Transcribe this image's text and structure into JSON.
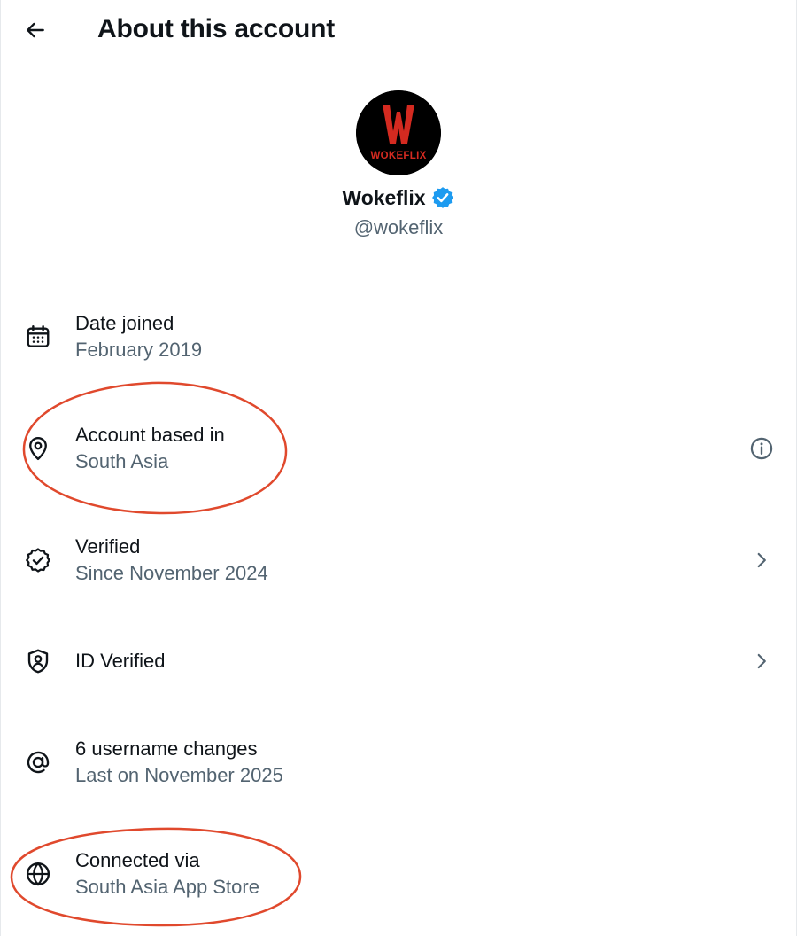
{
  "header": {
    "back_icon": "arrow-left-icon",
    "title": "About this account"
  },
  "profile": {
    "avatar_letter": "W",
    "avatar_wordmark": "WOKEFLIX",
    "name": "Wokeflix",
    "handle": "@wokeflix",
    "verified_badge_color": "#1d9bf0"
  },
  "rows": [
    {
      "icon": "calendar-icon",
      "title": "Date joined",
      "subtitle": "February 2019"
    },
    {
      "icon": "location-pin-icon",
      "title": "Account based in",
      "subtitle": "South Asia",
      "trailing": "info-icon"
    },
    {
      "icon": "verified-check-icon",
      "title": "Verified",
      "subtitle": "Since November 2024",
      "trailing": "chevron-right-icon"
    },
    {
      "icon": "id-shield-icon",
      "title": "ID Verified",
      "trailing": "chevron-right-icon"
    },
    {
      "icon": "at-sign-icon",
      "title": "6 username changes",
      "subtitle": "Last on November 2025"
    },
    {
      "icon": "globe-icon",
      "title": "Connected via",
      "subtitle": "South Asia App Store"
    }
  ],
  "colors": {
    "text_primary": "#0f1419",
    "text_secondary": "#536471",
    "annotation_circle": "#e0492d",
    "avatar_red": "#d42a20"
  }
}
